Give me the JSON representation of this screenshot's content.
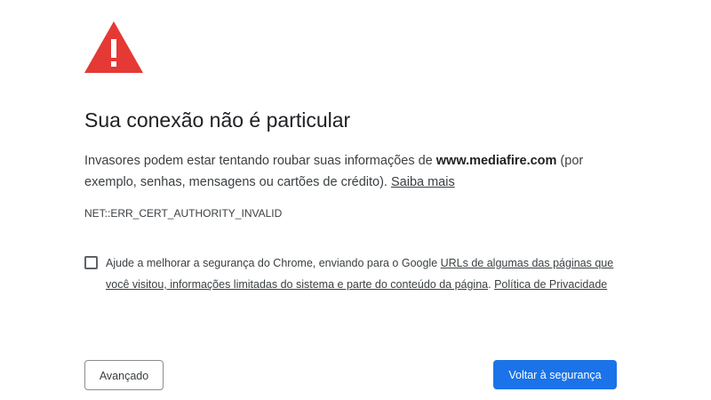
{
  "icon": {
    "name": "warning-triangle-icon",
    "color": "#e53935",
    "mark_color": "#ffffff"
  },
  "title": "Sua conexão não é particular",
  "body": {
    "text_before": "Invasores podem estar tentando roubar suas informações de ",
    "domain": "www.mediafire.com",
    "text_after": " (por exemplo, senhas, mensagens ou cartões de crédito). ",
    "learn_more_link": "Saiba mais"
  },
  "error_code": "NET::ERR_CERT_AUTHORITY_INVALID",
  "optin": {
    "checked": false,
    "text_before": "Ajude a melhorar a segurança do Chrome, enviando para o Google ",
    "link_urls": "URLs de algumas das páginas que você visitou, informações limitadas do sistema e parte do conteúdo da página",
    "separator": ". ",
    "link_privacy": "Política de Privacidade"
  },
  "buttons": {
    "advanced": "Avançado",
    "back_to_safety": "Voltar à segurança"
  },
  "colors": {
    "primary_button": "#1a73e8",
    "text": "#3c4043",
    "heading": "#202124"
  }
}
